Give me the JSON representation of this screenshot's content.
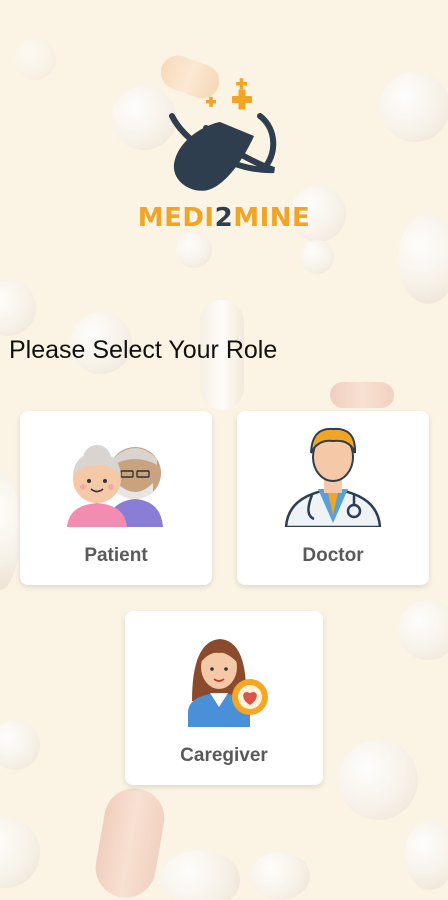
{
  "app": {
    "brand_part1": "MEDI",
    "brand_part2": "2",
    "brand_part3": "MINE"
  },
  "screen": {
    "title": "Please Select Your Role"
  },
  "roles": [
    {
      "label": "Patient",
      "icon": "elderly-couple-icon"
    },
    {
      "label": "Doctor",
      "icon": "doctor-icon"
    },
    {
      "label": "Caregiver",
      "icon": "caregiver-icon"
    }
  ],
  "colors": {
    "brand_orange": "#f0a526",
    "brand_navy": "#2e3e4e",
    "background": "#fbf3e3",
    "card": "#ffffff"
  }
}
